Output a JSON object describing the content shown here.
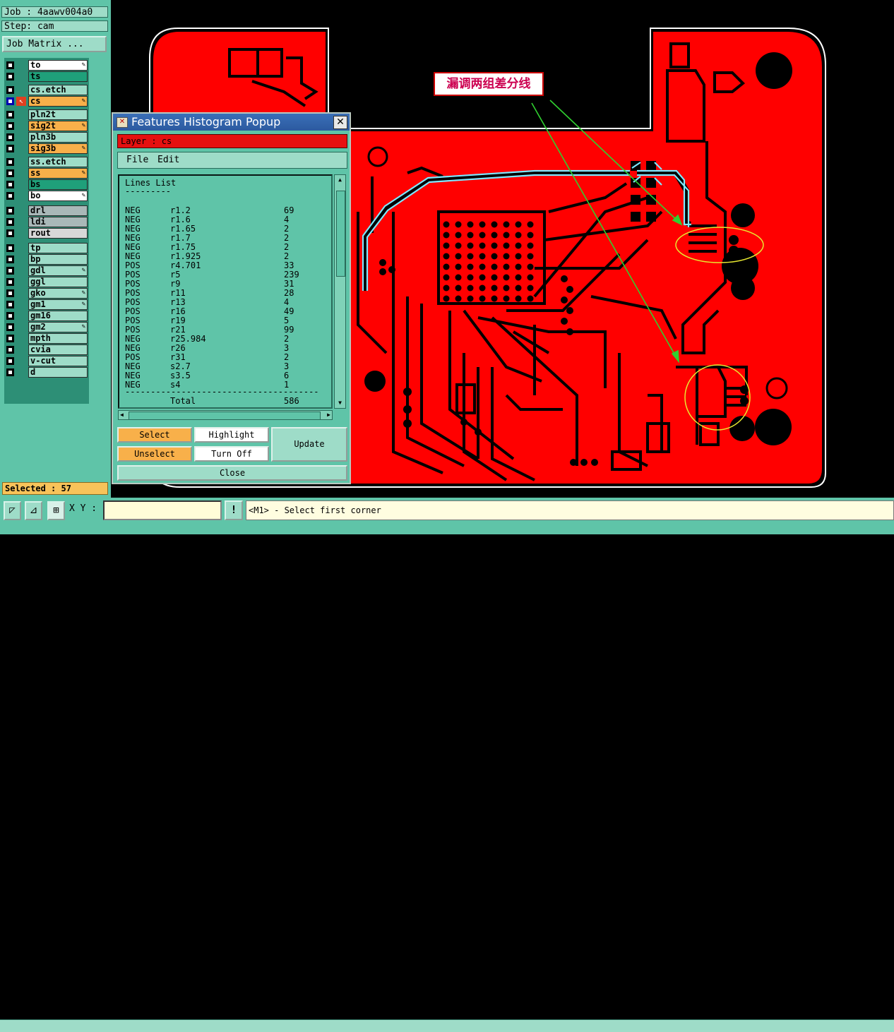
{
  "left_panel": {
    "job": "Job : 4aawv004a0",
    "step": "Step: cam",
    "job_matrix_button": "Job Matrix ...",
    "selected": "Selected : 57"
  },
  "layers": [
    {
      "name": "to",
      "color": "#ffffff",
      "pen": true
    },
    {
      "name": "ts",
      "color": "#1fa07a",
      "pen": false
    },
    {
      "name": "cs.etch",
      "color": "#9edcc8",
      "pen": false
    },
    {
      "name": "cs",
      "color": "#f8b04a",
      "pen": true,
      "active": true
    },
    {
      "name": "pln2t",
      "color": "#9edcc8",
      "pen": false
    },
    {
      "name": "sig2t",
      "color": "#f8b04a",
      "pen": true
    },
    {
      "name": "pln3b",
      "color": "#9edcc8",
      "pen": false
    },
    {
      "name": "sig3b",
      "color": "#f8b04a",
      "pen": true
    },
    {
      "name": "ss.etch",
      "color": "#9edcc8",
      "pen": false
    },
    {
      "name": "ss",
      "color": "#f8b04a",
      "pen": true
    },
    {
      "name": "bs",
      "color": "#1fa07a",
      "pen": false
    },
    {
      "name": "bo",
      "color": "#ffffff",
      "pen": true
    },
    {
      "name": "drl",
      "color": "#a9b8b8",
      "pen": false
    },
    {
      "name": "ldi",
      "color": "#a9b8b8",
      "pen": false
    },
    {
      "name": "rout",
      "color": "#d8d8d8",
      "pen": false
    },
    {
      "name": "tp",
      "color": "#9edcc8",
      "pen": false
    },
    {
      "name": "bp",
      "color": "#9edcc8",
      "pen": false
    },
    {
      "name": "gdl",
      "color": "#9edcc8",
      "pen": true
    },
    {
      "name": "ggl",
      "color": "#9edcc8",
      "pen": false
    },
    {
      "name": "gko",
      "color": "#9edcc8",
      "pen": true
    },
    {
      "name": "gm1",
      "color": "#9edcc8",
      "pen": true
    },
    {
      "name": "gm16",
      "color": "#9edcc8",
      "pen": false
    },
    {
      "name": "gm2",
      "color": "#9edcc8",
      "pen": true
    },
    {
      "name": "mpth",
      "color": "#9edcc8",
      "pen": false
    },
    {
      "name": "cvia",
      "color": "#9edcc8",
      "pen": false
    },
    {
      "name": "v-cut",
      "color": "#9edcc8",
      "pen": false
    },
    {
      "name": "d",
      "color": "#9edcc8",
      "pen": false
    }
  ],
  "annotation": "漏调两组差分线",
  "popup": {
    "title": "Features Histogram Popup",
    "layer_label": "Layer :  cs",
    "menu": {
      "file": "File",
      "edit": "Edit"
    },
    "list_title": "Lines List",
    "list_underline": "---------",
    "rows": [
      [
        "NEG",
        "r1.2",
        "69"
      ],
      [
        "NEG",
        "r1.6",
        "4"
      ],
      [
        "NEG",
        "r1.65",
        "2"
      ],
      [
        "NEG",
        "r1.7",
        "2"
      ],
      [
        "NEG",
        "r1.75",
        "2"
      ],
      [
        "NEG",
        "r1.925",
        "2"
      ],
      [
        "POS",
        "r4.701",
        "33"
      ],
      [
        "POS",
        "r5",
        "239"
      ],
      [
        "POS",
        "r9",
        "31"
      ],
      [
        "POS",
        "r11",
        "28"
      ],
      [
        "POS",
        "r13",
        "4"
      ],
      [
        "POS",
        "r16",
        "49"
      ],
      [
        "POS",
        "r19",
        "5"
      ],
      [
        "POS",
        "r21",
        "99"
      ],
      [
        "NEG",
        "r25.984",
        "2"
      ],
      [
        "NEG",
        "r26",
        "3"
      ],
      [
        "POS",
        "r31",
        "2"
      ],
      [
        "NEG",
        "s2.7",
        "3"
      ],
      [
        "NEG",
        "s3.5",
        "6"
      ],
      [
        "NEG",
        "s4",
        "1"
      ]
    ],
    "separator": "--------------------------------------",
    "total_label": "Total",
    "total_value": "586",
    "buttons": {
      "select": "Select",
      "unselect": "Unselect",
      "highlight": "Highlight",
      "turn_off": "Turn Off",
      "update": "Update",
      "close": "Close"
    }
  },
  "bottom": {
    "xy_label": "X Y :",
    "xy_value": "",
    "status": "<M1> - Select first corner"
  },
  "colors": {
    "board": "#ff0000",
    "traces": "#000000",
    "highlight": "#7fe8ff",
    "circle": "#e8e830",
    "arrow": "#30d030"
  }
}
